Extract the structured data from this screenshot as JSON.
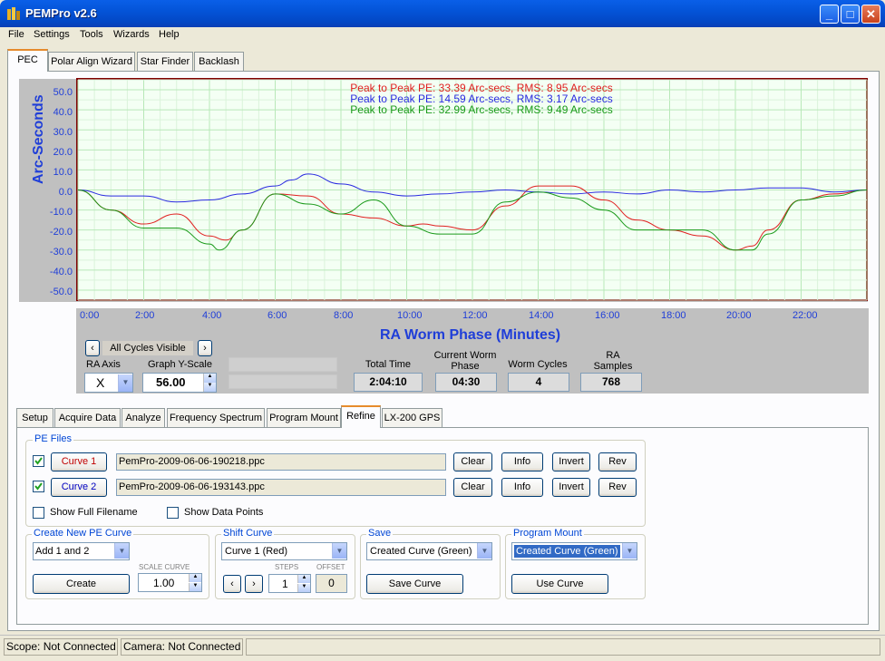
{
  "window": {
    "title": "PEMPro v2.6"
  },
  "menu": [
    "File",
    "Settings",
    "Tools",
    "Wizards",
    "Help"
  ],
  "top_tabs": [
    "PEC",
    "Polar Align Wizard",
    "Star Finder",
    "Backlash"
  ],
  "chart": {
    "legend": [
      {
        "text": "Peak to Peak PE: 33.39 Arc-secs,  RMS: 8.95 Arc-secs",
        "color": "#e02020"
      },
      {
        "text": "Peak to Peak PE: 14.59 Arc-secs,  RMS: 3.17 Arc-secs",
        "color": "#2a2ae0"
      },
      {
        "text": "Peak to Peak PE: 32.99 Arc-secs,  RMS: 9.49 Arc-secs",
        "color": "#1a9a1a"
      }
    ],
    "ylabel": "Arc-Seconds",
    "xlabel": "RA Worm Phase (Minutes)",
    "yticks": [
      "50.0",
      "40.0",
      "30.0",
      "20.0",
      "10.0",
      "0.0",
      "-10.0",
      "-20.0",
      "-30.0",
      "-40.0",
      "-50.0"
    ],
    "xticks": [
      "0:00",
      "2:00",
      "4:00",
      "6:00",
      "8:00",
      "10:00",
      "12:00",
      "14:00",
      "16:00",
      "18:00",
      "20:00",
      "22:00"
    ]
  },
  "chart_data": {
    "type": "line",
    "ylabel": "Arc-Seconds",
    "xlabel": "RA Worm Phase (Minutes)",
    "xlim": [
      0,
      24
    ],
    "ylim": [
      -55,
      55
    ],
    "series": [
      {
        "color": "#e02020",
        "x": [
          0,
          1,
          2,
          3,
          4,
          4.5,
          5,
          6,
          7,
          8,
          9,
          10,
          10.5,
          11,
          12,
          13,
          14,
          15,
          16,
          17,
          18,
          19,
          20,
          20.5,
          21,
          22,
          23,
          24
        ],
        "values": [
          0,
          -10,
          -17,
          -12,
          -23,
          -25,
          -20,
          -2,
          -3,
          -12,
          -14,
          -18,
          -17,
          -18,
          -20,
          -8,
          2,
          2,
          -5,
          -15,
          -20,
          -23,
          -30,
          -28,
          -20,
          -5,
          -2,
          0
        ]
      },
      {
        "color": "#2a2ae0",
        "x": [
          0,
          1,
          2,
          3,
          4,
          5,
          6,
          6.5,
          7,
          8,
          9,
          10,
          11,
          12,
          13,
          14,
          15,
          16,
          17,
          18,
          19,
          20,
          21,
          22,
          23,
          24
        ],
        "values": [
          0,
          -3,
          -3,
          -6,
          -5,
          -2,
          2,
          5,
          8,
          3,
          -1,
          -3,
          -2,
          -1,
          0,
          -1,
          -2,
          -1,
          -2,
          0,
          -1,
          0,
          1,
          1,
          -1,
          0
        ]
      },
      {
        "color": "#1a9a1a",
        "x": [
          0,
          1,
          2,
          3,
          4,
          4.3,
          5,
          6,
          7,
          8,
          9,
          10,
          11,
          12,
          13,
          14,
          15,
          16,
          17,
          18,
          19,
          20,
          20.5,
          21,
          22,
          23,
          24
        ],
        "values": [
          0,
          -10,
          -19,
          -19,
          -27,
          -30,
          -20,
          -2,
          -7,
          -12,
          -5,
          -18,
          -22,
          -22,
          -6,
          -1,
          -4,
          -10,
          -20,
          -20,
          -20,
          -30,
          -30,
          -22,
          -5,
          -3,
          0
        ]
      }
    ]
  },
  "controls": {
    "cycle_label": "All Cycles Visible",
    "ra_axis_label": "RA Axis",
    "ra_axis_value": "X",
    "graph_yscale_label": "Graph Y-Scale",
    "graph_yscale_value": "56.00",
    "total_time_label": "Total Time",
    "total_time_value": "2:04:10",
    "current_worm_label": "Current Worm Phase",
    "current_worm_value": "04:30",
    "worm_cycles_label": "Worm Cycles",
    "worm_cycles_value": "4",
    "ra_samples_label": "RA Samples",
    "ra_samples_value": "768"
  },
  "bottom_tabs": [
    "Setup",
    "Acquire Data",
    "Analyze",
    "Frequency Spectrum",
    "Program Mount",
    "Refine",
    "LX-200 GPS"
  ],
  "pe_files": {
    "title": "PE Files",
    "rows": [
      {
        "curve": "Curve 1",
        "file": "PemPro-2009-06-06-190218.ppc",
        "checked": true
      },
      {
        "curve": "Curve 2",
        "file": "PemPro-2009-06-06-193143.ppc",
        "checked": true
      }
    ],
    "buttons": [
      "Clear",
      "Info",
      "Invert",
      "Rev"
    ],
    "show_full_filename": "Show Full Filename",
    "show_data_points": "Show Data Points"
  },
  "create_curve": {
    "title": "Create New PE Curve",
    "select": "Add 1 and  2",
    "create": "Create",
    "scale_label": "SCALE CURVE",
    "scale_value": "1.00"
  },
  "shift_curve": {
    "title": "Shift Curve",
    "select": "Curve 1 (Red)",
    "steps_label": "STEPS",
    "offset_label": "OFFSET",
    "steps_value": "1",
    "offset_value": "0"
  },
  "save": {
    "title": "Save",
    "select": "Created Curve (Green)",
    "button": "Save Curve"
  },
  "program_mount": {
    "title": "Program Mount",
    "select": "Created Curve (Green)",
    "button": "Use Curve"
  },
  "status": {
    "scope": "Scope: Not Connected",
    "camera": "Camera: Not Connected"
  }
}
